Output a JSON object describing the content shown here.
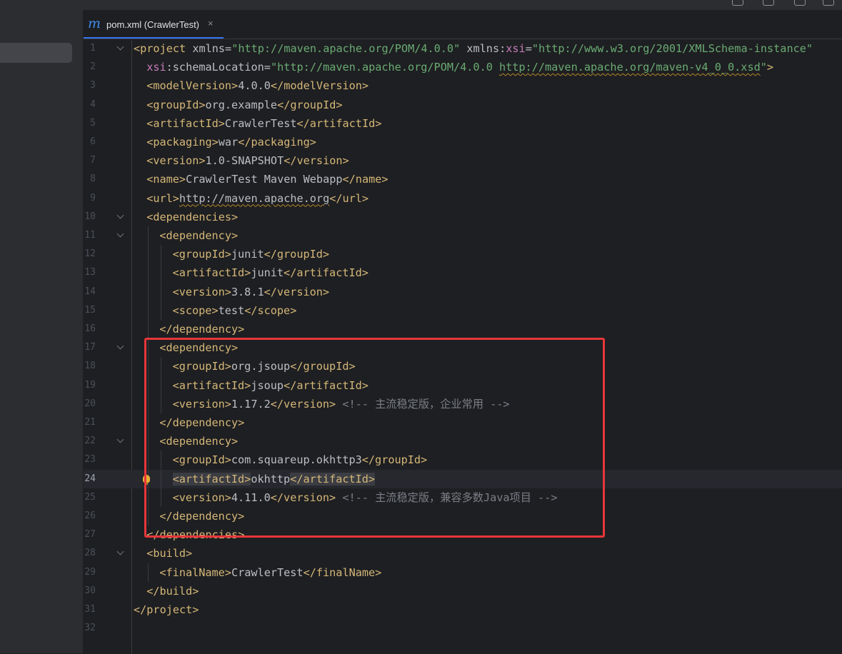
{
  "tab": {
    "title": "pom.xml (CrawlerTest)",
    "icon": "maven-m-icon",
    "close": "×"
  },
  "current_line": 24,
  "lines": [
    {
      "n": "1"
    },
    {
      "n": "2"
    },
    {
      "n": "3"
    },
    {
      "n": "4"
    },
    {
      "n": "5"
    },
    {
      "n": "6"
    },
    {
      "n": "7"
    },
    {
      "n": "8"
    },
    {
      "n": "9"
    },
    {
      "n": "10"
    },
    {
      "n": "11"
    },
    {
      "n": "12"
    },
    {
      "n": "13"
    },
    {
      "n": "14"
    },
    {
      "n": "15"
    },
    {
      "n": "16"
    },
    {
      "n": "17"
    },
    {
      "n": "18"
    },
    {
      "n": "19"
    },
    {
      "n": "20"
    },
    {
      "n": "21"
    },
    {
      "n": "22"
    },
    {
      "n": "23"
    },
    {
      "n": "24"
    },
    {
      "n": "25"
    },
    {
      "n": "26"
    },
    {
      "n": "27"
    },
    {
      "n": "28"
    },
    {
      "n": "29"
    },
    {
      "n": "30"
    },
    {
      "n": "31"
    },
    {
      "n": "32"
    }
  ],
  "code": {
    "project_open": "<project",
    "xmlns_attr": "xmlns",
    "xmlns_val": "\"http://maven.apache.org/POM/4.0.0\"",
    "xsi_ns_attr": "xmlns:",
    "xsi": "xsi",
    "xsi_val": "\"http://www.w3.org/2001/XMLSchema-instance\"",
    "schema_attr": "schemaLocation",
    "schema_val_a": "\"http://maven.apache.org/POM/4.0.0 ",
    "schema_val_b": "http://maven.apache.org/maven-v4_0_0.xsd",
    "schema_val_c": "\"",
    "modelVersion": "4.0.0",
    "groupId": "org.example",
    "artifactId": "CrawlerTest",
    "packaging": "war",
    "version": "1.0-SNAPSHOT",
    "name": "CrawlerTest Maven Webapp",
    "url": "http://maven.apache.org",
    "dep1_groupId": "junit",
    "dep1_artifactId": "junit",
    "dep1_version": "3.8.1",
    "dep1_scope": "test",
    "dep2_groupId": "org.jsoup",
    "dep2_artifactId": "jsoup",
    "dep2_version": "1.17.2",
    "dep2_comment": "<!-- 主流稳定版，企业常用 -->",
    "dep3_groupId": "com.squareup.okhttp3",
    "dep3_artifactId": "okhttp",
    "dep3_version": "4.11.0",
    "dep3_comment": "<!-- 主流稳定版，兼容多数Java项目 -->",
    "finalName": "CrawlerTest"
  },
  "colors": {
    "tag": "#d5b778",
    "value": "#6aab73",
    "namespace": "#c77dbb",
    "comment": "#7a7e85",
    "text": "#bcbec4",
    "highlight_box": "#e8363a"
  }
}
